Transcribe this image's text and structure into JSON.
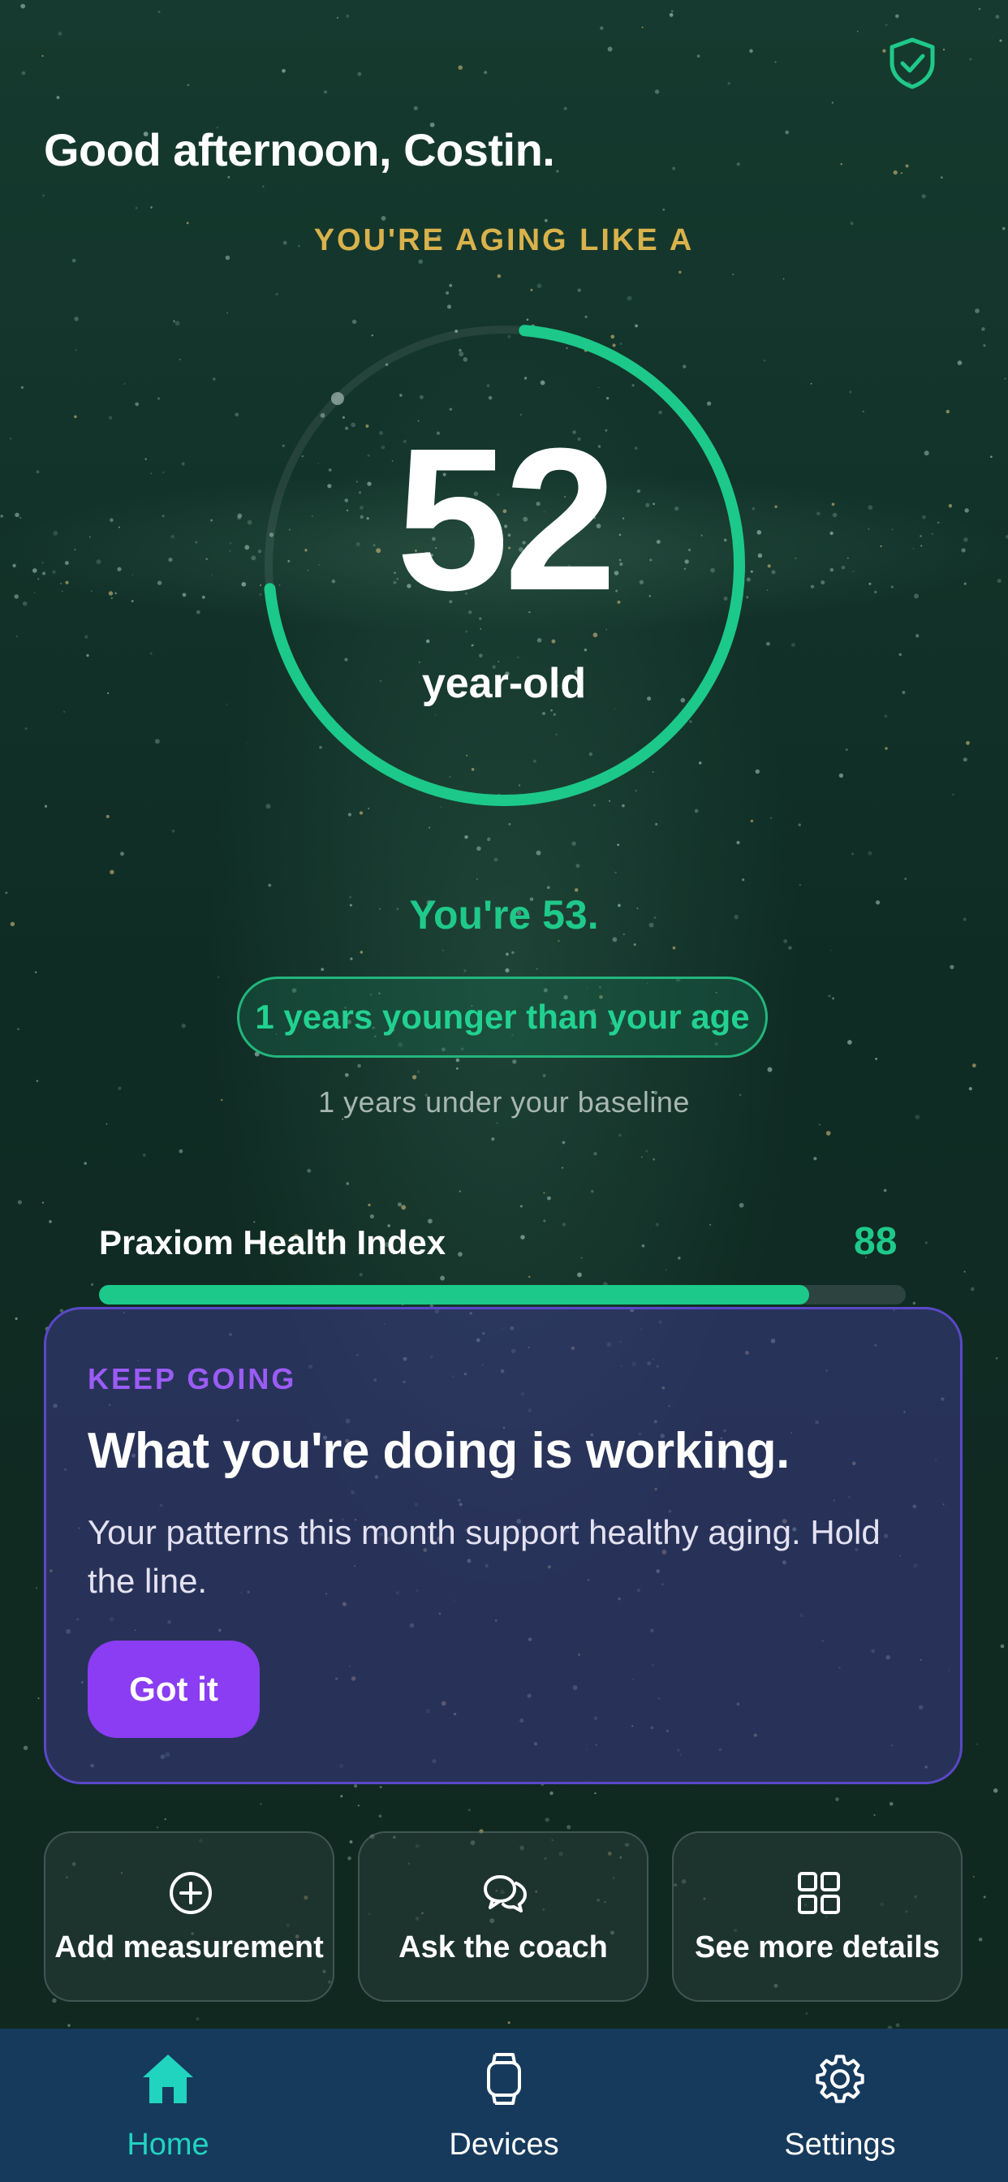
{
  "header": {
    "greeting": "Good afternoon, Costin.",
    "shield_icon": "shield-check-icon"
  },
  "biological_age": {
    "label": "YOU'RE AGING LIKE A",
    "value": "52",
    "unit": "year-old",
    "ring_progress": 0.72,
    "real_age_text": "You're 53.",
    "difference_text": "1 years younger than your age",
    "baseline_text": "1 years under your baseline"
  },
  "health_index": {
    "label": "Praxiom Health Index",
    "value": "88",
    "progress": 0.88
  },
  "card": {
    "eyebrow": "KEEP GOING",
    "title": "What you're doing is working.",
    "body": "Your patterns this month support healthy aging. Hold the line.",
    "button_label": "Got it"
  },
  "actions": [
    {
      "label": "Add measurement",
      "icon": "plus-circle-icon"
    },
    {
      "label": "Ask the coach",
      "icon": "chat-bubbles-icon"
    },
    {
      "label": "See more details",
      "icon": "grid-icon"
    }
  ],
  "nav": {
    "items": [
      {
        "label": "Home",
        "icon": "home-icon",
        "active": true
      },
      {
        "label": "Devices",
        "icon": "watch-icon",
        "active": false
      },
      {
        "label": "Settings",
        "icon": "gear-icon",
        "active": false
      }
    ]
  },
  "colors": {
    "accent_green": "#1fc98a",
    "gold": "#d9b24c",
    "purple": "#8a3df2",
    "nav_background": "#163a5c",
    "nav_active": "#20d4c0"
  }
}
